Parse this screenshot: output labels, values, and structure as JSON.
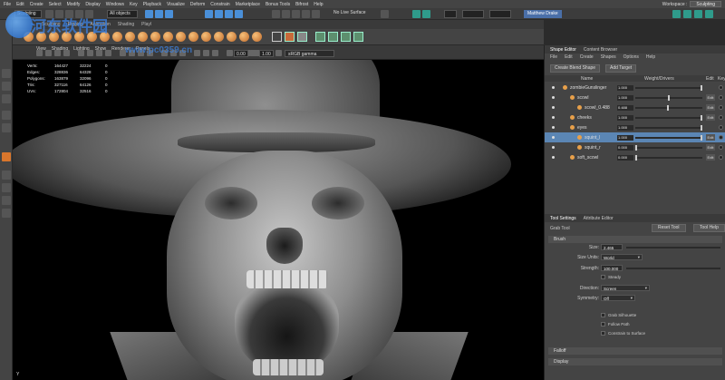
{
  "menubar": {
    "items": [
      "File",
      "Edit",
      "Create",
      "Select",
      "Modify",
      "Display",
      "Windows",
      "Key",
      "Playback",
      "Visualize",
      "Deform",
      "Constrain",
      "Marketplace",
      "Bonus Tools",
      "Bifrost",
      "Help"
    ],
    "workspace_label": "Workspace :",
    "workspace_value": "Sculpting"
  },
  "statusline": {
    "mode": "Sculpting",
    "objects": "All objects",
    "live_surface": "No Live Surface",
    "user": "Matthew Drake"
  },
  "shelf": {
    "tabs": [
      "Curves/Surfaces",
      "Poly Modeling",
      "Sculpting",
      "Rigging",
      "Animation",
      "Rendering",
      "FX",
      "FX Caching",
      "Custom",
      "Arnold",
      "Bifrost",
      "MASH",
      "Motion Graphics",
      "XGen"
    ],
    "visible_tabs": [
      "Sculpting",
      "Rigging",
      "Animation",
      "Shading",
      "Playl"
    ]
  },
  "watermark": {
    "site": "河东软件园",
    "url": "www.pc0359.cn"
  },
  "viewport": {
    "menus": [
      "View",
      "Shading",
      "Lighting",
      "Show",
      "Renderer",
      "Panels"
    ],
    "exposure": "0.00",
    "gamma": "1.00",
    "colorspace": "sRGB gamma",
    "hud": {
      "rows": [
        {
          "label": "Verts:",
          "a": "164427",
          "b": "32224",
          "c": "0"
        },
        {
          "label": "Edges:",
          "a": "328836",
          "b": "64328",
          "c": "0"
        },
        {
          "label": "Polygons:",
          "a": "163879",
          "b": "32096",
          "c": "0"
        },
        {
          "label": "Tris:",
          "a": "327116",
          "b": "64126",
          "c": "0"
        },
        {
          "label": "UVs:",
          "a": "172804",
          "b": "32516",
          "c": "0"
        }
      ]
    },
    "axis": "Y"
  },
  "shape_editor": {
    "tabs": [
      "Shape Editor",
      "Content Browser"
    ],
    "menus": [
      "File",
      "Edit",
      "Create",
      "Shapes",
      "Options",
      "Help"
    ],
    "create_blend_shape": "Create Blend Shape",
    "add_target": "Add Target",
    "columns": {
      "name": "Name",
      "weight": "Weight/Drivers",
      "edit": "Edit",
      "key": "Key"
    },
    "rows": [
      {
        "name": "zombieGunslinger",
        "weight": "1.000",
        "handle": 1.0,
        "indent": 0,
        "edit": ""
      },
      {
        "name": "scowl",
        "weight": "1.000",
        "handle": 0.5,
        "indent": 1,
        "edit": "Edit"
      },
      {
        "name": "scowl_0.488",
        "weight": "0.488",
        "handle": 0.49,
        "indent": 2,
        "edit": "Edit"
      },
      {
        "name": "cheeks",
        "weight": "1.000",
        "handle": 1.0,
        "indent": 1,
        "edit": "Edit"
      },
      {
        "name": "eyes",
        "weight": "1.000",
        "handle": 1.0,
        "indent": 1,
        "edit": ""
      },
      {
        "name": "squint_l",
        "weight": "1.000",
        "handle": 1.0,
        "indent": 2,
        "edit": "Edit",
        "selected": true
      },
      {
        "name": "squint_r",
        "weight": "0.000",
        "handle": 0.0,
        "indent": 2,
        "edit": "Edit"
      },
      {
        "name": "soft_scowl",
        "weight": "0.000",
        "handle": 0.0,
        "indent": 1,
        "edit": "Edit"
      }
    ]
  },
  "tool_settings": {
    "tabs": [
      "Tool Settings",
      "Attribute Editor"
    ],
    "tool_name": "Grab Tool",
    "reset_tool": "Reset Tool",
    "tool_help": "Tool Help",
    "brush_section": "Brush",
    "size_label": "Size:",
    "size_value": "2.465",
    "size_units_label": "Size Units:",
    "size_units_value": "World",
    "strength_label": "Strength:",
    "strength_value": "100.000",
    "steady_label": "Steady",
    "direction_label": "Direction:",
    "direction_value": "Screen",
    "symmetry_label": "Symmetry:",
    "symmetry_value": "Off",
    "checks": [
      "Grab Silhouette",
      "Follow Path",
      "Constrain to Surface"
    ],
    "sections": [
      "Falloff",
      "Display"
    ]
  },
  "colors": {
    "accent_blue": "#5b86b4",
    "active_tool": "#d9762c",
    "shape_icon": "#e8a04a"
  }
}
